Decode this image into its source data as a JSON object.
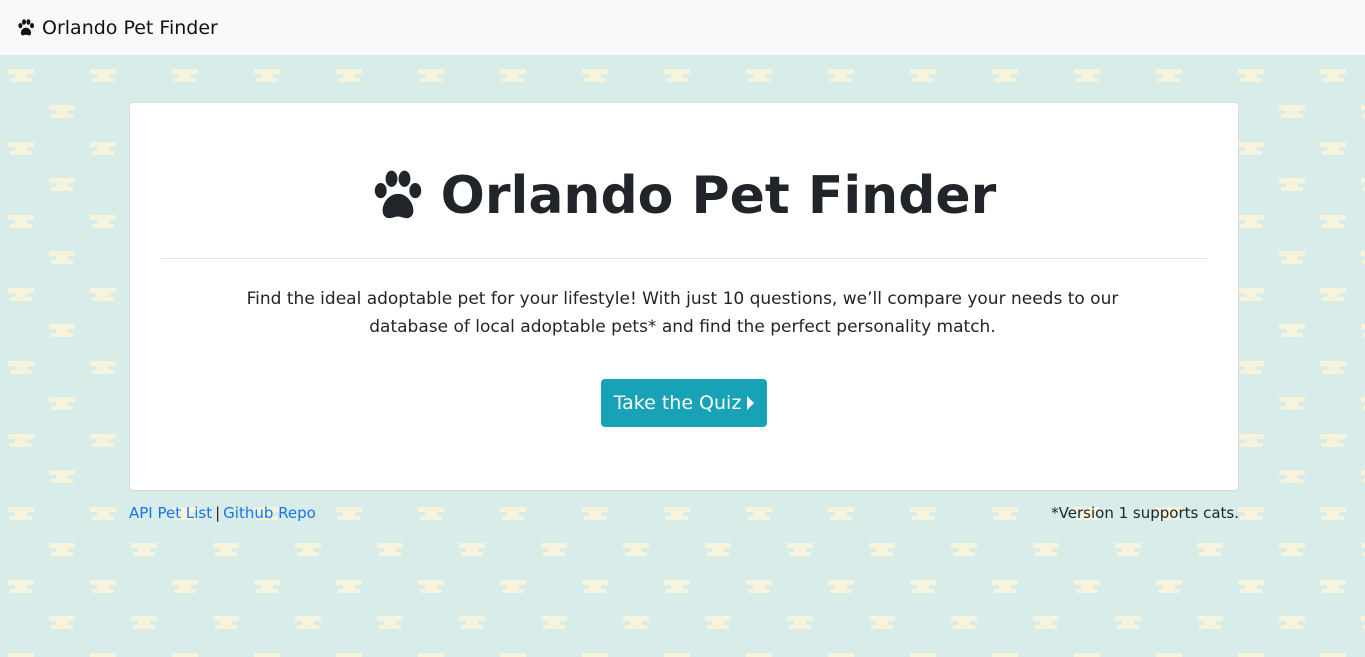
{
  "navbar": {
    "brand": "Orlando Pet Finder",
    "icon": "paw-icon"
  },
  "hero": {
    "title": "Orlando Pet Finder",
    "icon": "paw-icon",
    "lead": "Find the ideal adoptable pet for your lifestyle! With just 10 questions, we’ll compare your needs to our database of local adoptable pets* and find the perfect personality match.",
    "cta_label": "Take the Quiz"
  },
  "footer": {
    "link_api": "API Pet List",
    "separator": "|",
    "link_github": "Github Repo",
    "version_note": "*Version 1 supports cats."
  },
  "colors": {
    "background": "#d8ecea",
    "pattern": "#f6f4dc",
    "navbar": "#f8f9fa",
    "button": "#17a2b8",
    "link": "#1a73e8"
  }
}
